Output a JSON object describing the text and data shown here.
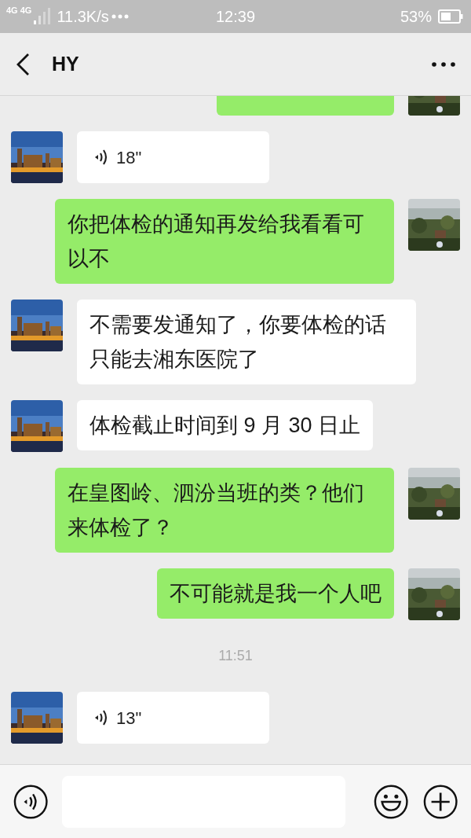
{
  "status_bar": {
    "network_labels": [
      "4G",
      "4G"
    ],
    "speed": "11.3K/s",
    "time": "12:39",
    "battery": "53%"
  },
  "header": {
    "title": "HY"
  },
  "messages": [
    {
      "kind": "partial",
      "outgoing": true
    },
    {
      "kind": "voice",
      "outgoing": false,
      "duration": "18\""
    },
    {
      "kind": "text",
      "outgoing": true,
      "text": "你把体检的通知再发给我看看可以不"
    },
    {
      "kind": "text",
      "outgoing": false,
      "text": "不需要发通知了，你要体检的话只能去湘东医院了"
    },
    {
      "kind": "text",
      "outgoing": false,
      "text": "体检截止时间到 9 月 30 日止"
    },
    {
      "kind": "text",
      "outgoing": true,
      "text": "在皇图岭、泗汾当班的类？他们来体检了？"
    },
    {
      "kind": "text",
      "outgoing": true,
      "text": "不可能就是我一个人吧"
    },
    {
      "kind": "time",
      "text": "11:51"
    },
    {
      "kind": "voice",
      "outgoing": false,
      "duration": "13\""
    }
  ]
}
